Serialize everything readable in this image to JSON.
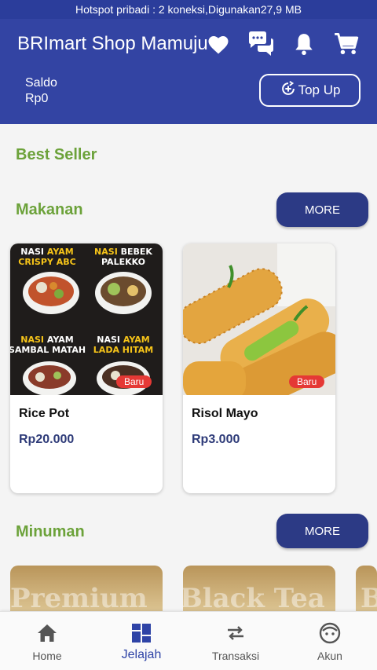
{
  "status_bar": {
    "text": "Hotspot pribadi : 2 koneksi,Digunakan27,9 MB"
  },
  "header": {
    "title": "BRImart Shop Mamuju",
    "icons": [
      "heart-icon",
      "chat-icon",
      "bell-icon",
      "cart-icon"
    ],
    "saldo_label": "Saldo",
    "saldo_value": "Rp0",
    "topup_label": "Top Up",
    "color": "#3344a3"
  },
  "sections": {
    "best_seller": "Best Seller",
    "makanan": "Makanan",
    "minuman": "Minuman",
    "more_label": "MORE"
  },
  "makanan_items": [
    {
      "name": "Rice Pot",
      "price": "Rp20.000",
      "badge": "Baru",
      "image_texts": [
        "NASI AYAM CRISPY ABC",
        "NASI BEBEK PALEKKO",
        "NASI AYAM SAMBAL MATAH",
        "NASI AYAM LADA HITAM"
      ]
    },
    {
      "name": "Risol Mayo",
      "price": "Rp3.000",
      "badge": "Baru"
    }
  ],
  "minuman_items": [
    {
      "image_text": "Premium"
    },
    {
      "image_text": "Black Tea L"
    },
    {
      "image_text": "B"
    }
  ],
  "bottom_nav": [
    {
      "label": "Home",
      "icon": "home-icon"
    },
    {
      "label": "Jelajah",
      "icon": "grid-icon",
      "active": true
    },
    {
      "label": "Transaksi",
      "icon": "swap-icon"
    },
    {
      "label": "Akun",
      "icon": "face-icon"
    }
  ],
  "colors": {
    "accent": "#2c3a85",
    "section_green": "#6ca23a",
    "badge_red": "#e53935"
  }
}
